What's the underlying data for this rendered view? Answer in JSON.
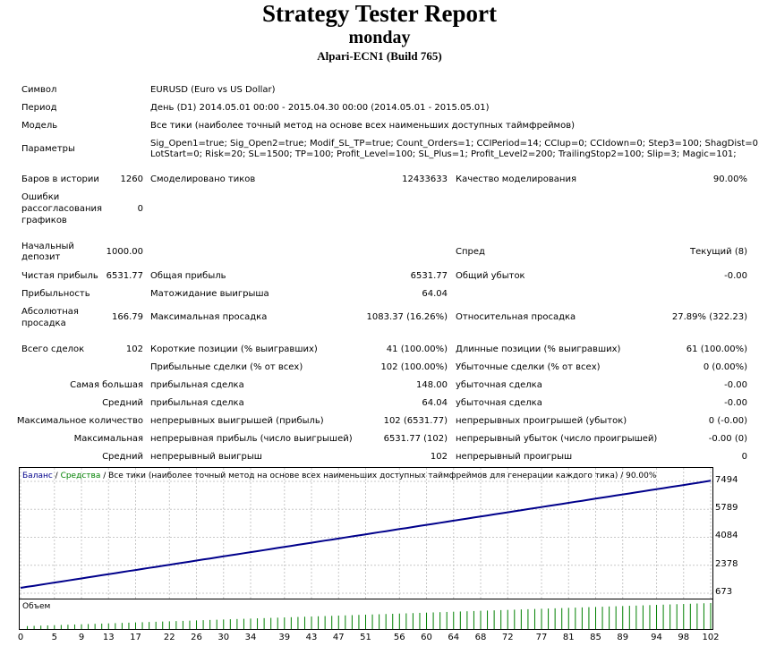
{
  "header": {
    "title": "Strategy Tester Report",
    "subtitle": "monday",
    "server": "Alpari-ECN1 (Build 765)"
  },
  "info": {
    "symbol_label": "Символ",
    "symbol_value": "EURUSD (Euro vs US Dollar)",
    "period_label": "Период",
    "period_value": "День (D1) 2014.05.01 00:00 - 2015.04.30 00:00 (2014.05.01 - 2015.05.01)",
    "model_label": "Модель",
    "model_value": "Все тики (наиболее точный метод на основе всех наименьших доступных таймфреймов)",
    "params_label": "Параметры",
    "params_line1": "Sig_Open1=true; Sig_Open2=true; Modif_SL_TP=true; Count_Orders=1; CCIPeriod=14; CCIup=0; CCIdown=0; Step3=100; ShagDist=0;",
    "params_line2": "LotStart=0; Risk=20; SL=1500; TP=100; Profit_Level=100; SL_Plus=1; Profit_Level2=200; TrailingStop2=100; Slip=3; Magic=101;"
  },
  "stats": {
    "bars_label": "Баров в истории",
    "bars_value": "1260",
    "ticks_label": "Смоделировано тиков",
    "ticks_value": "12433633",
    "quality_label": "Качество моделирования",
    "quality_value": "90.00%",
    "errors_label1": "Ошибки",
    "errors_label2": "рассогласования",
    "errors_label3": "графиков",
    "errors_value": "0",
    "deposit_label1": "Начальный",
    "deposit_label2": "депозит",
    "deposit_value": "1000.00",
    "spread_label": "Спред",
    "spread_value": "Текущий (8)",
    "net_label": "Чистая прибыль",
    "net_value": "6531.77",
    "gross_profit_label": "Общая прибыль",
    "gross_profit_value": "6531.77",
    "gross_loss_label": "Общий убыток",
    "gross_loss_value": "-0.00",
    "pf_label": "Прибыльность",
    "expected_label": "Матожидание выигрыша",
    "expected_value": "64.04",
    "abs_dd_label1": "Абсолютная",
    "abs_dd_label2": "просадка",
    "abs_dd_value": "166.79",
    "max_dd_label": "Максимальная просадка",
    "max_dd_value": "1083.37 (16.26%)",
    "rel_dd_label": "Относительная просадка",
    "rel_dd_value": "27.89% (322.23)",
    "trades_label": "Всего сделок",
    "trades_value": "102",
    "short_label": "Короткие позиции (% выигравших)",
    "short_value": "41 (100.00%)",
    "long_label": "Длинные позиции (% выигравших)",
    "long_value": "61 (100.00%)",
    "prof_trades_label": "Прибыльные сделки (% от всех)",
    "prof_trades_value": "102 (100.00%)",
    "loss_trades_label": "Убыточные сделки (% от всех)",
    "loss_trades_value": "0 (0.00%)",
    "largest_label": "Самая большая",
    "largest_profit_label": "прибыльная сделка",
    "largest_profit_value": "148.00",
    "largest_loss_label": "убыточная сделка",
    "largest_loss_value": "-0.00",
    "average_label": "Средний",
    "avg_profit_label": "прибыльная сделка",
    "avg_profit_value": "64.04",
    "avg_loss_label": "убыточная сделка",
    "avg_loss_value": "-0.00",
    "max_count_label": "Максимальное количество",
    "cons_wins_label": "непрерывных выигрышей (прибыль)",
    "cons_wins_value": "102 (6531.77)",
    "cons_losses_label": "непрерывных проигрышей (убыток)",
    "cons_losses_value": "0 (-0.00)",
    "maximal_label": "Максимальная",
    "cons_profit_label": "непрерывная прибыль (число выигрышей)",
    "cons_profit_value": "6531.77 (102)",
    "cons_loss_label": "непрерывный убыток (число проигрышей)",
    "cons_loss_value": "-0.00 (0)",
    "avg2_label": "Средний",
    "avg_cons_wins_label": "непрерывный выигрыш",
    "avg_cons_wins_value": "102",
    "avg_cons_losses_label": "непрерывный проигрыш",
    "avg_cons_losses_value": "0"
  },
  "legend": {
    "balance": "Баланс",
    "sep1": " / ",
    "equity": "Средства",
    "rest": " / Все тики (наиболее точный метод на основе всех наименьших доступных таймфреймов для генерации каждого тика) / 90.00%",
    "balance_color": "#00008b",
    "equity_color": "#008000"
  },
  "volume_title": "Объем",
  "chart_data": {
    "type": "line",
    "x": [
      0,
      102
    ],
    "xticks": [
      0,
      5,
      9,
      13,
      17,
      22,
      26,
      30,
      34,
      39,
      43,
      47,
      51,
      56,
      60,
      64,
      68,
      72,
      77,
      81,
      85,
      89,
      94,
      98,
      102
    ],
    "yticks": [
      7494,
      5789,
      4084,
      2378,
      673
    ],
    "ylim": [
      673,
      7494
    ],
    "series": [
      {
        "name": "Баланс",
        "values": [
          1000,
          1064,
          1128,
          1192,
          1256,
          1320,
          1384,
          1448,
          1512,
          1576,
          1640,
          1704,
          1768,
          1832,
          1896,
          1960,
          2024,
          2088,
          2152,
          2216,
          2280,
          2344,
          2408,
          2472,
          2536,
          2600,
          2664,
          2728,
          2792,
          2856,
          2920,
          2984,
          3048,
          3112,
          3176,
          3240,
          3304,
          3368,
          3432,
          3496,
          3560,
          3624,
          3688,
          3752,
          3816,
          3880,
          3944,
          4008,
          4072,
          4136,
          4200,
          4264,
          4328,
          4392,
          4456,
          4520,
          4584,
          4648,
          4712,
          4776,
          4840,
          4904,
          4968,
          5032,
          5096,
          5160,
          5224,
          5288,
          5352,
          5416,
          5480,
          5544,
          5608,
          5672,
          5736,
          5800,
          5864,
          5928,
          5992,
          6056,
          6120,
          6184,
          6248,
          6312,
          6376,
          6440,
          6504,
          6568,
          6632,
          6696,
          6760,
          6824,
          6888,
          6952,
          7016,
          7080,
          7144,
          7208,
          7272,
          7336,
          7400,
          7464,
          7531.77
        ]
      }
    ]
  }
}
